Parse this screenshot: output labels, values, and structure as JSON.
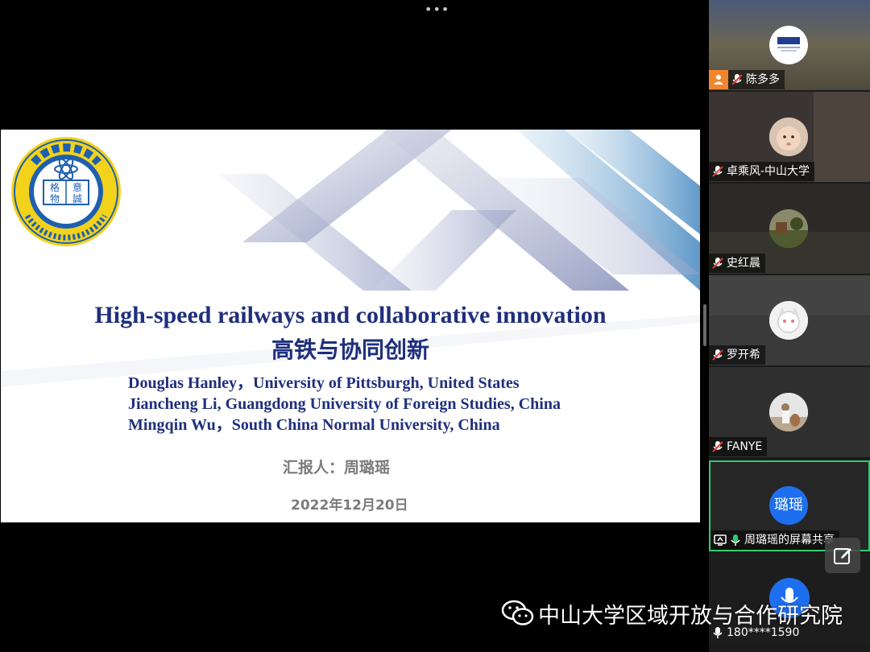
{
  "toolbar": {
    "more_label": "•••"
  },
  "slide": {
    "logo_text": "澳門科技大學 MACAU UNIVERSITY OF SCIENCE AND TECHNOLOGY 格意物誠",
    "title_en": "High-speed railways and collaborative innovation",
    "title_zh": "高铁与协同创新",
    "authors": [
      "Douglas Hanley，University of Pittsburgh, United States",
      "Jiancheng Li, Guangdong University of Foreign Studies, China",
      "Mingqin Wu，South China Normal University, China"
    ],
    "reporter": "汇报人：周璐瑶",
    "date": "2022年12月20日"
  },
  "participants": [
    {
      "name": "陈多多",
      "muted": true,
      "host": true
    },
    {
      "name": "卓乘风-中山大学",
      "muted": true
    },
    {
      "name": "史红晨",
      "muted": true
    },
    {
      "name": "罗开希",
      "muted": true
    },
    {
      "name": "FANYE",
      "muted": true
    },
    {
      "name": "周璐瑶的屏幕共享",
      "avatar_text": "璐瑶",
      "sharing": true
    },
    {
      "name": "180****1590"
    }
  ],
  "watermark": {
    "text": "中山大学区域开放与合作研究院"
  },
  "colors": {
    "active_border": "#2ecc71",
    "host_badge": "#f2862e",
    "avatar_blue": "#1e6ff0",
    "title_blue": "#1f2f7c"
  }
}
